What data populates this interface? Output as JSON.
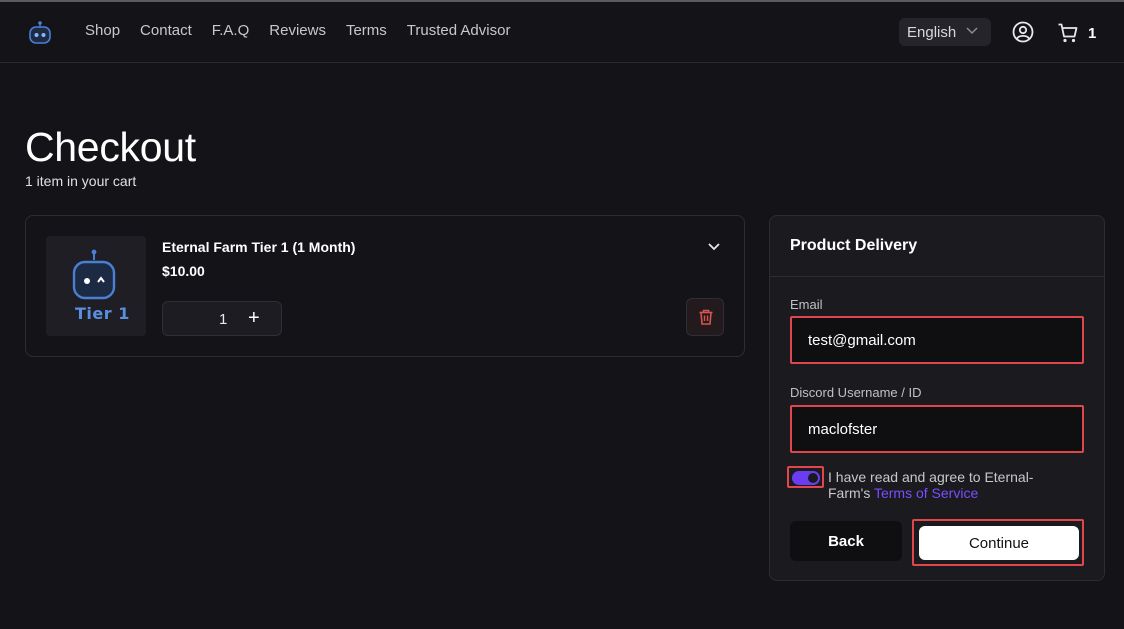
{
  "nav": {
    "links": [
      "Shop",
      "Contact",
      "F.A.Q",
      "Reviews",
      "Terms",
      "Trusted Advisor"
    ],
    "language": "English",
    "cart_count": "1"
  },
  "page": {
    "title": "Checkout",
    "subtitle": "1 item in your cart"
  },
  "cart": {
    "items": [
      {
        "name": "Eternal Farm Tier 1 (1 Month)",
        "price": "$10.00",
        "quantity": "1",
        "thumb_label": "Tier 1"
      }
    ]
  },
  "delivery": {
    "title": "Product Delivery",
    "email_label": "Email",
    "email_value": "test@gmail.com",
    "discord_label": "Discord Username / ID",
    "discord_value": "maclofster",
    "agree_text": "I have read and agree to Eternal-Farm's ",
    "tos_link": "Terms of Service",
    "agreed": true,
    "back_label": "Back",
    "continue_label": "Continue"
  },
  "colors": {
    "background": "#141418",
    "accent": "#6a3ef0",
    "link": "#7c4dff",
    "highlight_box": "#e0474c"
  },
  "icons": {
    "logo": "robot-logo-icon",
    "language_chevron": "chevron-down-icon",
    "account": "user-circle-icon",
    "cart": "shopping-cart-icon",
    "collapse": "chevron-down-icon",
    "delete": "trash-icon",
    "quantity_increase": "plus-icon"
  }
}
